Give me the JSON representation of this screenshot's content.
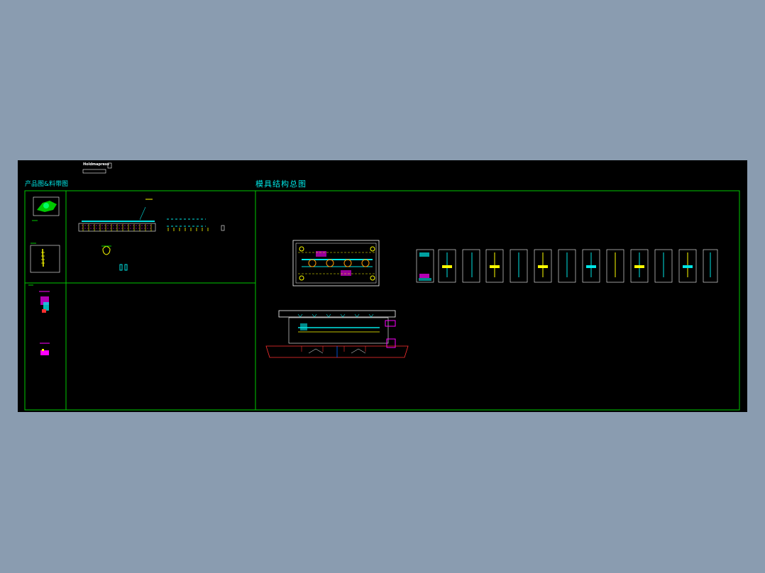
{
  "header": {
    "logo_text": "Holdmapress"
  },
  "sections": {
    "product_and_strip": {
      "title": "产品图&料带图"
    },
    "die_structure": {
      "title": "模具结构总图"
    }
  },
  "colors": {
    "background": "#8a9cb0",
    "sheet": "#000000",
    "frame": "#00c800",
    "cyan": "#00e5e5",
    "yellow": "#ffff00",
    "magenta": "#ff00ff",
    "red": "#ff3030",
    "white": "#ffffff",
    "orange": "#ff9900"
  }
}
